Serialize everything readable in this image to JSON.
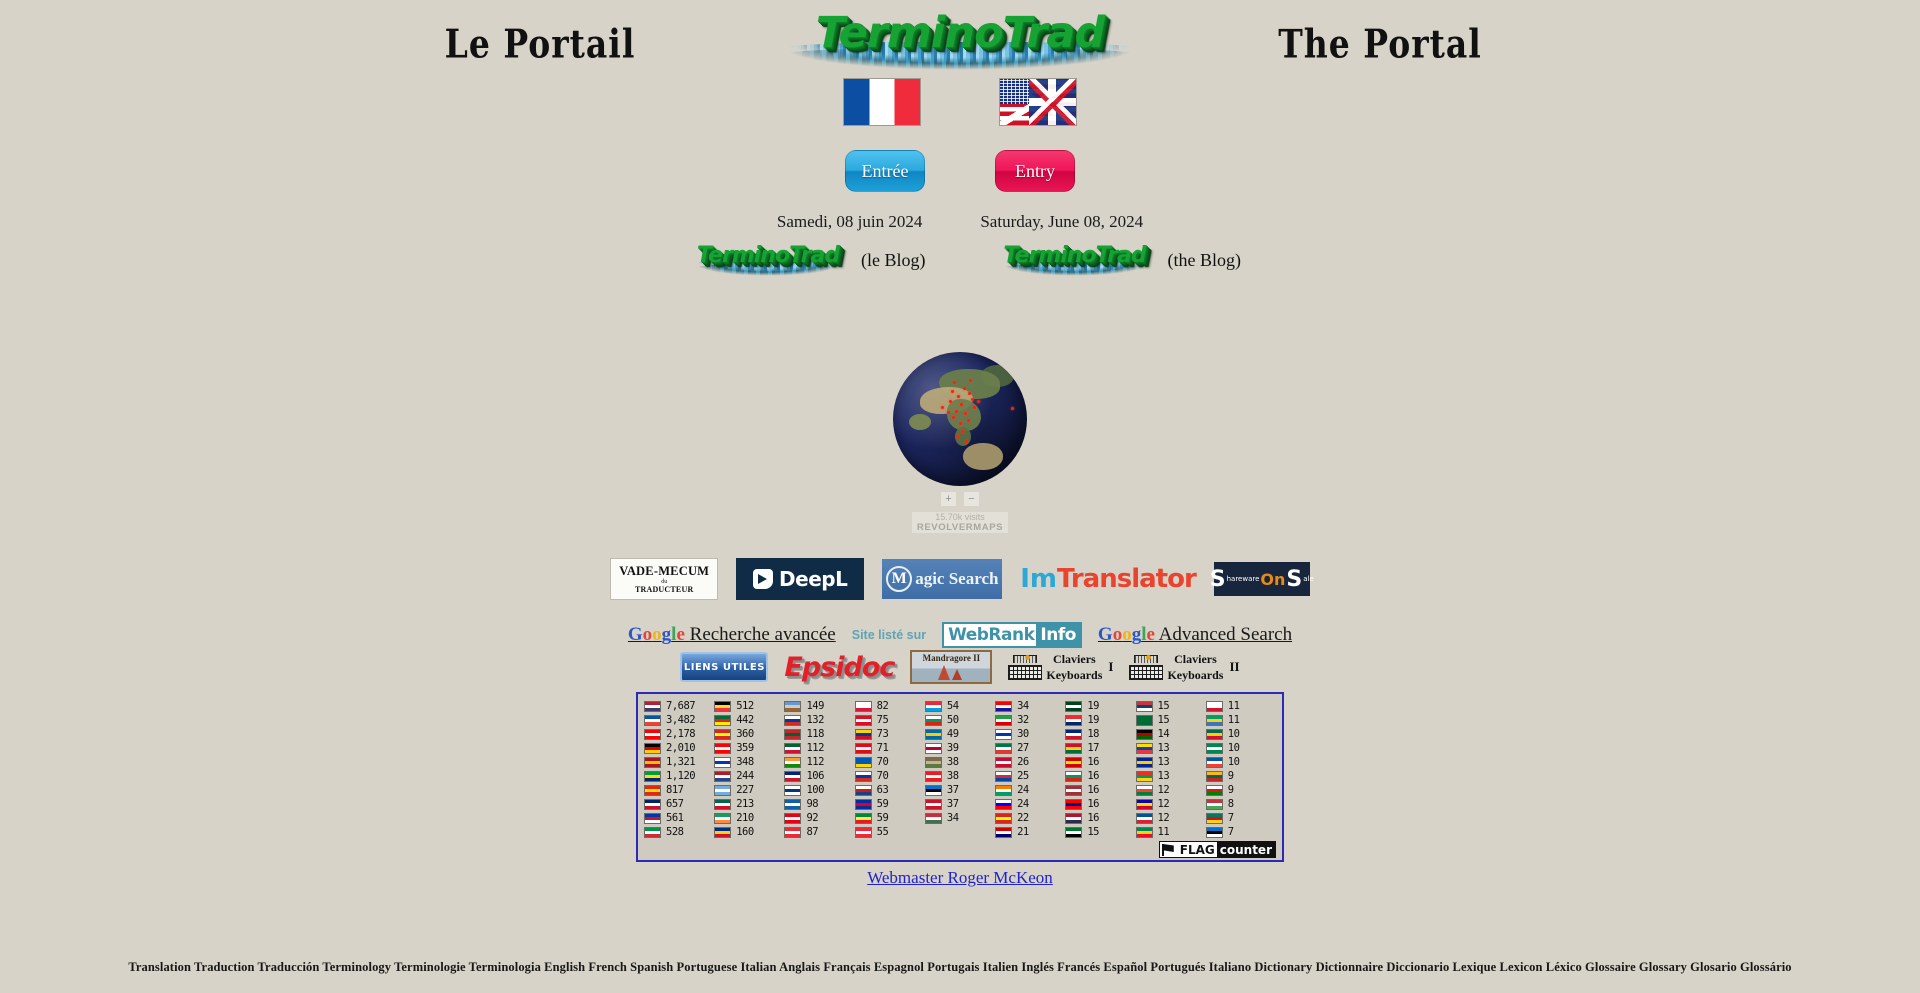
{
  "site": {
    "title_fr": "Le Portail",
    "title_en": "The Portal",
    "logo_wordmark": "TerminoTrad"
  },
  "flags": {
    "fr_alt": "french-flag",
    "en_alt": "us-uk-flag"
  },
  "entry": {
    "fr_label": "Entrée",
    "en_label": "Entry",
    "fr_color": "#1ea0d8",
    "en_color": "#ef1558"
  },
  "dates": {
    "fr": "Samedi, 08 juin 2024",
    "en": "Saturday, June 08, 2024"
  },
  "blogs": [
    {
      "wordmark": "TerminoTrad",
      "label": "(le Blog)"
    },
    {
      "wordmark": "TerminoTrad",
      "label": "(the Blog)"
    }
  ],
  "revolvermaps": {
    "zoom_in": "+",
    "zoom_out": "−",
    "visits": "15.70k visits",
    "brand": "REVOLVERMAPS"
  },
  "tools": [
    {
      "name": "vade-mecum",
      "line1": "VADE-MECUM",
      "line2": "du",
      "line3": "TRADUCTEUR"
    },
    {
      "name": "deepl",
      "label": "DeepL"
    },
    {
      "name": "magic-search",
      "initial": "M",
      "label": "agic Search"
    },
    {
      "name": "imtranslator",
      "part1": "Im",
      "part2": "Translator"
    },
    {
      "name": "shareware-on-sale",
      "s1": "S",
      "w1": "hareware",
      "on": "On",
      "s2": "S",
      "w2": "ale"
    }
  ],
  "search": {
    "google_letters": [
      "G",
      "o",
      "o",
      "g",
      "l",
      "e"
    ],
    "fr_link": "Recherche avancée",
    "en_link": "Advanced Search",
    "webrank_label": "Site listé sur",
    "webrank_a": "WebRank",
    "webrank_b": "Info"
  },
  "links_row": {
    "liens_utiles": "LIENS UTILES",
    "epsidoc": "Epsidoc",
    "mandragore": "Mandragore II",
    "keyboards": [
      {
        "top": "Claviers",
        "bottom": "Keyboards",
        "roman": "I"
      },
      {
        "top": "Claviers",
        "bottom": "Keyboards",
        "roman": "II"
      }
    ]
  },
  "flag_counter": {
    "badge_flag": "FLAG",
    "badge_counter": "counter",
    "columns": [
      [
        {
          "country": "United States",
          "colors": [
            "#b22234",
            "#ffffff",
            "#3c3b6e"
          ],
          "count": "7,687"
        },
        {
          "country": "France",
          "colors": [
            "#0055a4",
            "#ffffff",
            "#ef4135"
          ],
          "count": "3,482"
        },
        {
          "country": "Canada",
          "colors": [
            "#ff0000",
            "#ffffff",
            "#ff0000"
          ],
          "count": "2,178"
        },
        {
          "country": "Germany",
          "colors": [
            "#000000",
            "#dd0000",
            "#ffce00"
          ],
          "count": "2,010"
        },
        {
          "country": "Spain",
          "colors": [
            "#aa151b",
            "#f1bf00",
            "#aa151b"
          ],
          "count": "1,321"
        },
        {
          "country": "Brazil",
          "colors": [
            "#009b3a",
            "#fedf00",
            "#002776"
          ],
          "count": "1,120"
        },
        {
          "country": "China",
          "colors": [
            "#de2910",
            "#ffde00",
            "#de2910"
          ],
          "count": "817"
        },
        {
          "country": "United Kingdom",
          "colors": [
            "#012169",
            "#ffffff",
            "#c8102e"
          ],
          "count": "657"
        },
        {
          "country": "Philippines",
          "colors": [
            "#0038a8",
            "#ce1126",
            "#ffffff"
          ],
          "count": "561"
        },
        {
          "country": "Italy",
          "colors": [
            "#009246",
            "#ffffff",
            "#ce2b37"
          ],
          "count": "528"
        }
      ],
      [
        {
          "country": "Belgium",
          "colors": [
            "#000000",
            "#fdda24",
            "#ef3340"
          ],
          "count": "512"
        },
        {
          "country": "Portugal",
          "colors": [
            "#046a38",
            "#da291c",
            "#ffe900"
          ],
          "count": "442"
        },
        {
          "country": "Vietnam",
          "colors": [
            "#da251d",
            "#ffff00",
            "#da251d"
          ],
          "count": "360"
        },
        {
          "country": "Switzerland",
          "colors": [
            "#ff0000",
            "#ffffff",
            "#ff0000"
          ],
          "count": "359"
        },
        {
          "country": "Israel",
          "colors": [
            "#ffffff",
            "#0038b8",
            "#ffffff"
          ],
          "count": "348"
        },
        {
          "country": "Netherlands",
          "colors": [
            "#ae1c28",
            "#ffffff",
            "#21468b"
          ],
          "count": "244"
        },
        {
          "country": "Argentina",
          "colors": [
            "#74acdf",
            "#ffffff",
            "#74acdf"
          ],
          "count": "227"
        },
        {
          "country": "Mexico",
          "colors": [
            "#006847",
            "#ffffff",
            "#ce1126"
          ],
          "count": "213"
        },
        {
          "country": "Ireland",
          "colors": [
            "#169b62",
            "#ffffff",
            "#ff883e"
          ],
          "count": "210"
        },
        {
          "country": "Romania",
          "colors": [
            "#002b7f",
            "#fcd116",
            "#ce1126"
          ],
          "count": "160"
        }
      ],
      [
        {
          "country": "Unknown",
          "colors": [
            "#6699cc",
            "#cccccc",
            "#996633"
          ],
          "count": "149"
        },
        {
          "country": "Russia",
          "colors": [
            "#ffffff",
            "#0039a6",
            "#d52b1e"
          ],
          "count": "132"
        },
        {
          "country": "Morocco",
          "colors": [
            "#c1272d",
            "#006233",
            "#c1272d"
          ],
          "count": "118"
        },
        {
          "country": "Algeria",
          "colors": [
            "#006233",
            "#ffffff",
            "#d21034"
          ],
          "count": "112"
        },
        {
          "country": "India",
          "colors": [
            "#ff9933",
            "#ffffff",
            "#138808"
          ],
          "count": "112"
        },
        {
          "country": "Australia",
          "colors": [
            "#00247d",
            "#ffffff",
            "#cc142b"
          ],
          "count": "106"
        },
        {
          "country": "Finland",
          "colors": [
            "#ffffff",
            "#003580",
            "#ffffff"
          ],
          "count": "100"
        },
        {
          "country": "Greece",
          "colors": [
            "#0d5eaf",
            "#ffffff",
            "#0d5eaf"
          ],
          "count": "98"
        },
        {
          "country": "Tunisia",
          "colors": [
            "#e70013",
            "#ffffff",
            "#e70013"
          ],
          "count": "92"
        },
        {
          "country": "Austria",
          "colors": [
            "#ed2939",
            "#ffffff",
            "#ed2939"
          ],
          "count": "87"
        }
      ],
      [
        {
          "country": "Poland",
          "colors": [
            "#ffffff",
            "#ffffff",
            "#dc143c"
          ],
          "count": "82"
        },
        {
          "country": "Peru",
          "colors": [
            "#d91023",
            "#ffffff",
            "#d91023"
          ],
          "count": "75"
        },
        {
          "country": "Colombia",
          "colors": [
            "#fcd116",
            "#003893",
            "#ce1126"
          ],
          "count": "73"
        },
        {
          "country": "Turkey",
          "colors": [
            "#e30a17",
            "#ffffff",
            "#e30a17"
          ],
          "count": "71"
        },
        {
          "country": "Ukraine",
          "colors": [
            "#0057b7",
            "#0057b7",
            "#ffd700"
          ],
          "count": "70"
        },
        {
          "country": "Chile",
          "colors": [
            "#ffffff",
            "#0039a6",
            "#d52b1e"
          ],
          "count": "70"
        },
        {
          "country": "Czechia",
          "colors": [
            "#ffffff",
            "#d7141a",
            "#11457e"
          ],
          "count": "63"
        },
        {
          "country": "Cambodia",
          "colors": [
            "#032ea1",
            "#e00025",
            "#032ea1"
          ],
          "count": "59"
        },
        {
          "country": "Senegal",
          "colors": [
            "#00853f",
            "#fdef42",
            "#e31b23"
          ],
          "count": "59"
        },
        {
          "country": "Singapore",
          "colors": [
            "#ed2939",
            "#ffffff",
            "#ed2939"
          ],
          "count": "55"
        }
      ],
      [
        {
          "country": "Luxembourg",
          "colors": [
            "#ed2939",
            "#ffffff",
            "#00a1de"
          ],
          "count": "54"
        },
        {
          "country": "Bulgaria",
          "colors": [
            "#ffffff",
            "#00966e",
            "#d62612"
          ],
          "count": "50"
        },
        {
          "country": "Sweden",
          "colors": [
            "#006aa7",
            "#fecc00",
            "#006aa7"
          ],
          "count": "49"
        },
        {
          "country": "Japan",
          "colors": [
            "#ffffff",
            "#bc002d",
            "#ffffff"
          ],
          "count": "39"
        },
        {
          "country": "Unknown",
          "colors": [
            "#7a6a4f",
            "#c8b48a",
            "#5c7a3f"
          ],
          "count": "38"
        },
        {
          "country": "Lebanon",
          "colors": [
            "#ed1c24",
            "#ffffff",
            "#ed1c24"
          ],
          "count": "38"
        },
        {
          "country": "Estonia",
          "colors": [
            "#0072ce",
            "#000000",
            "#ffffff"
          ],
          "count": "37"
        },
        {
          "country": "Indonesia",
          "colors": [
            "#ce1126",
            "#ffffff",
            "#ce1126"
          ],
          "count": "37"
        },
        {
          "country": "Hungary",
          "colors": [
            "#cd2a3e",
            "#ffffff",
            "#436f4d"
          ],
          "count": "34"
        }
      ],
      [
        {
          "country": "Croatia",
          "colors": [
            "#ff0000",
            "#ffffff",
            "#171796"
          ],
          "count": "34"
        },
        {
          "country": "Iran",
          "colors": [
            "#239f40",
            "#ffffff",
            "#da0000"
          ],
          "count": "32"
        },
        {
          "country": "Uruguay",
          "colors": [
            "#ffffff",
            "#0038a8",
            "#ffffff"
          ],
          "count": "30"
        },
        {
          "country": "South Africa",
          "colors": [
            "#007749",
            "#ffffff",
            "#de3831"
          ],
          "count": "27"
        },
        {
          "country": "Denmark",
          "colors": [
            "#c60c30",
            "#ffffff",
            "#c60c30"
          ],
          "count": "26"
        },
        {
          "country": "South Korea",
          "colors": [
            "#ffffff",
            "#cd2e3a",
            "#0047a0"
          ],
          "count": "25"
        },
        {
          "country": "Côte d'Ivoire",
          "colors": [
            "#f77f00",
            "#ffffff",
            "#009e60"
          ],
          "count": "24"
        },
        {
          "country": "Slovenia",
          "colors": [
            "#ffffff",
            "#0000ff",
            "#ff0000"
          ],
          "count": "24"
        },
        {
          "country": "Vietnam",
          "colors": [
            "#da251d",
            "#ffff00",
            "#da251d"
          ],
          "count": "22"
        },
        {
          "country": "Malaysia",
          "colors": [
            "#cc0001",
            "#ffffff",
            "#010066"
          ],
          "count": "21"
        }
      ],
      [
        {
          "country": "Pakistan",
          "colors": [
            "#01411c",
            "#ffffff",
            "#01411c"
          ],
          "count": "19"
        },
        {
          "country": "Norway",
          "colors": [
            "#ef2b2d",
            "#ffffff",
            "#002868"
          ],
          "count": "19"
        },
        {
          "country": "New Zealand",
          "colors": [
            "#00247d",
            "#ffffff",
            "#cc142b"
          ],
          "count": "18"
        },
        {
          "country": "Ghana",
          "colors": [
            "#ce1126",
            "#fcd116",
            "#006b3f"
          ],
          "count": "17"
        },
        {
          "country": "North Macedonia",
          "colors": [
            "#d20000",
            "#ffe600",
            "#d20000"
          ],
          "count": "16"
        },
        {
          "country": "Bulgaria",
          "colors": [
            "#ffffff",
            "#00966e",
            "#d62612"
          ],
          "count": "16"
        },
        {
          "country": "Latvia",
          "colors": [
            "#9e3039",
            "#ffffff",
            "#9e3039"
          ],
          "count": "16"
        },
        {
          "country": "Taiwan",
          "colors": [
            "#fe0000",
            "#000095",
            "#fe0000"
          ],
          "count": "16"
        },
        {
          "country": "Thailand",
          "colors": [
            "#a51931",
            "#ffffff",
            "#2d2a4a"
          ],
          "count": "16"
        },
        {
          "country": "United Arab Emirates",
          "colors": [
            "#00732f",
            "#ffffff",
            "#000000"
          ],
          "count": "15"
        }
      ],
      [
        {
          "country": "Serbia",
          "colors": [
            "#c6363c",
            "#0c4076",
            "#ffffff"
          ],
          "count": "15"
        },
        {
          "country": "Saudi Arabia",
          "colors": [
            "#006c35",
            "#006c35",
            "#006c35"
          ],
          "count": "15"
        },
        {
          "country": "Kenya",
          "colors": [
            "#000000",
            "#bb0000",
            "#006600"
          ],
          "count": "14"
        },
        {
          "country": "Ecuador",
          "colors": [
            "#ffdd00",
            "#0047ab",
            "#ef3340"
          ],
          "count": "13"
        },
        {
          "country": "Bosnia and Herzegovina",
          "colors": [
            "#002395",
            "#fecb00",
            "#002395"
          ],
          "count": "13"
        },
        {
          "country": "Burkina Faso",
          "colors": [
            "#ef2b2d",
            "#009e49",
            "#fcd116"
          ],
          "count": "13"
        },
        {
          "country": "Madagascar",
          "colors": [
            "#ffffff",
            "#fc3d32",
            "#007e3a"
          ],
          "count": "12"
        },
        {
          "country": "Andorra",
          "colors": [
            "#10069f",
            "#fedf00",
            "#d50032"
          ],
          "count": "12"
        },
        {
          "country": "Iceland",
          "colors": [
            "#02529c",
            "#ffffff",
            "#dc1e35"
          ],
          "count": "12"
        },
        {
          "country": "Benin",
          "colors": [
            "#008751",
            "#fcd20a",
            "#e8112d"
          ],
          "count": "11"
        }
      ],
      [
        {
          "country": "Malta",
          "colors": [
            "#ffffff",
            "#ffffff",
            "#cf142b"
          ],
          "count": "11"
        },
        {
          "country": "Gabon",
          "colors": [
            "#009e60",
            "#fcd116",
            "#3a75c4"
          ],
          "count": "11"
        },
        {
          "country": "Togo",
          "colors": [
            "#006a4e",
            "#ffce00",
            "#d21034"
          ],
          "count": "10"
        },
        {
          "country": "Nigeria",
          "colors": [
            "#008751",
            "#ffffff",
            "#008751"
          ],
          "count": "10"
        },
        {
          "country": "France",
          "colors": [
            "#0055a4",
            "#ffffff",
            "#ef4135"
          ],
          "count": "10"
        },
        {
          "country": "Lithuania",
          "colors": [
            "#fdb913",
            "#006a44",
            "#c1272d"
          ],
          "count": "9"
        },
        {
          "country": "Oman",
          "colors": [
            "#ffffff",
            "#db161b",
            "#008000"
          ],
          "count": "9"
        },
        {
          "country": "Belarus",
          "colors": [
            "#c8313e",
            "#ffffff",
            "#4aa657"
          ],
          "count": "8"
        },
        {
          "country": "Cameroon",
          "colors": [
            "#007a5e",
            "#ce1126",
            "#fcd116"
          ],
          "count": "7"
        },
        {
          "country": "Estonia",
          "colors": [
            "#0072ce",
            "#000000",
            "#ffffff"
          ],
          "count": "7"
        }
      ]
    ]
  },
  "webmaster": {
    "label": "Webmaster Roger McKeon"
  },
  "footer": {
    "keywords": "Translation Traduction Traducción Terminology Terminologie Terminologia English French Spanish Portuguese Italian Anglais Français Espagnol Portugais Italien Inglés Francés Español Portugués Italiano Dictionary Dictionnaire Diccionario Lexique Lexicon Léxico Glossaire Glossary Glosario Glossário"
  },
  "colors": {
    "background": "#d7d3c8",
    "logo_green": "#16a333",
    "logo_wing": "#4f9dc7",
    "link_blue": "#2222cc",
    "flagcounter_border": "#2a2ab5"
  }
}
